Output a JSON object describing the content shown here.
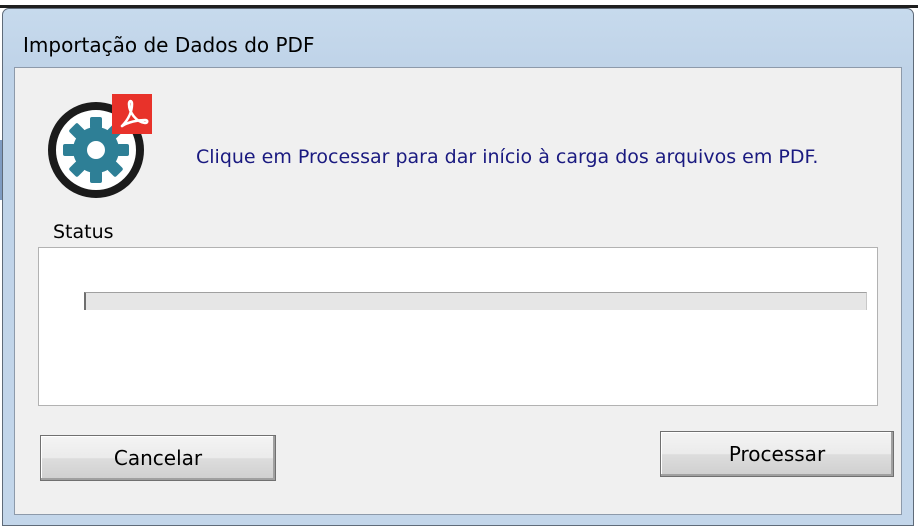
{
  "window": {
    "title": "Importação de Dados do PDF"
  },
  "message": "Clique em Processar para dar início à carga dos arquivos em PDF.",
  "status_group": {
    "label": "Status",
    "progress": 0
  },
  "buttons": {
    "cancel_label": "Cancelar",
    "process_label": "Processar"
  },
  "logo": {
    "icons": [
      "gear-icon",
      "pdf-icon"
    ],
    "colors": {
      "gear": "#2e7f96",
      "ring": "#1b1b1b",
      "pdf_badge": "#e8322a"
    }
  },
  "colors": {
    "message_text": "#1a1a80",
    "client_bg": "#f0f0f0",
    "frame": "#c3d6ea"
  }
}
